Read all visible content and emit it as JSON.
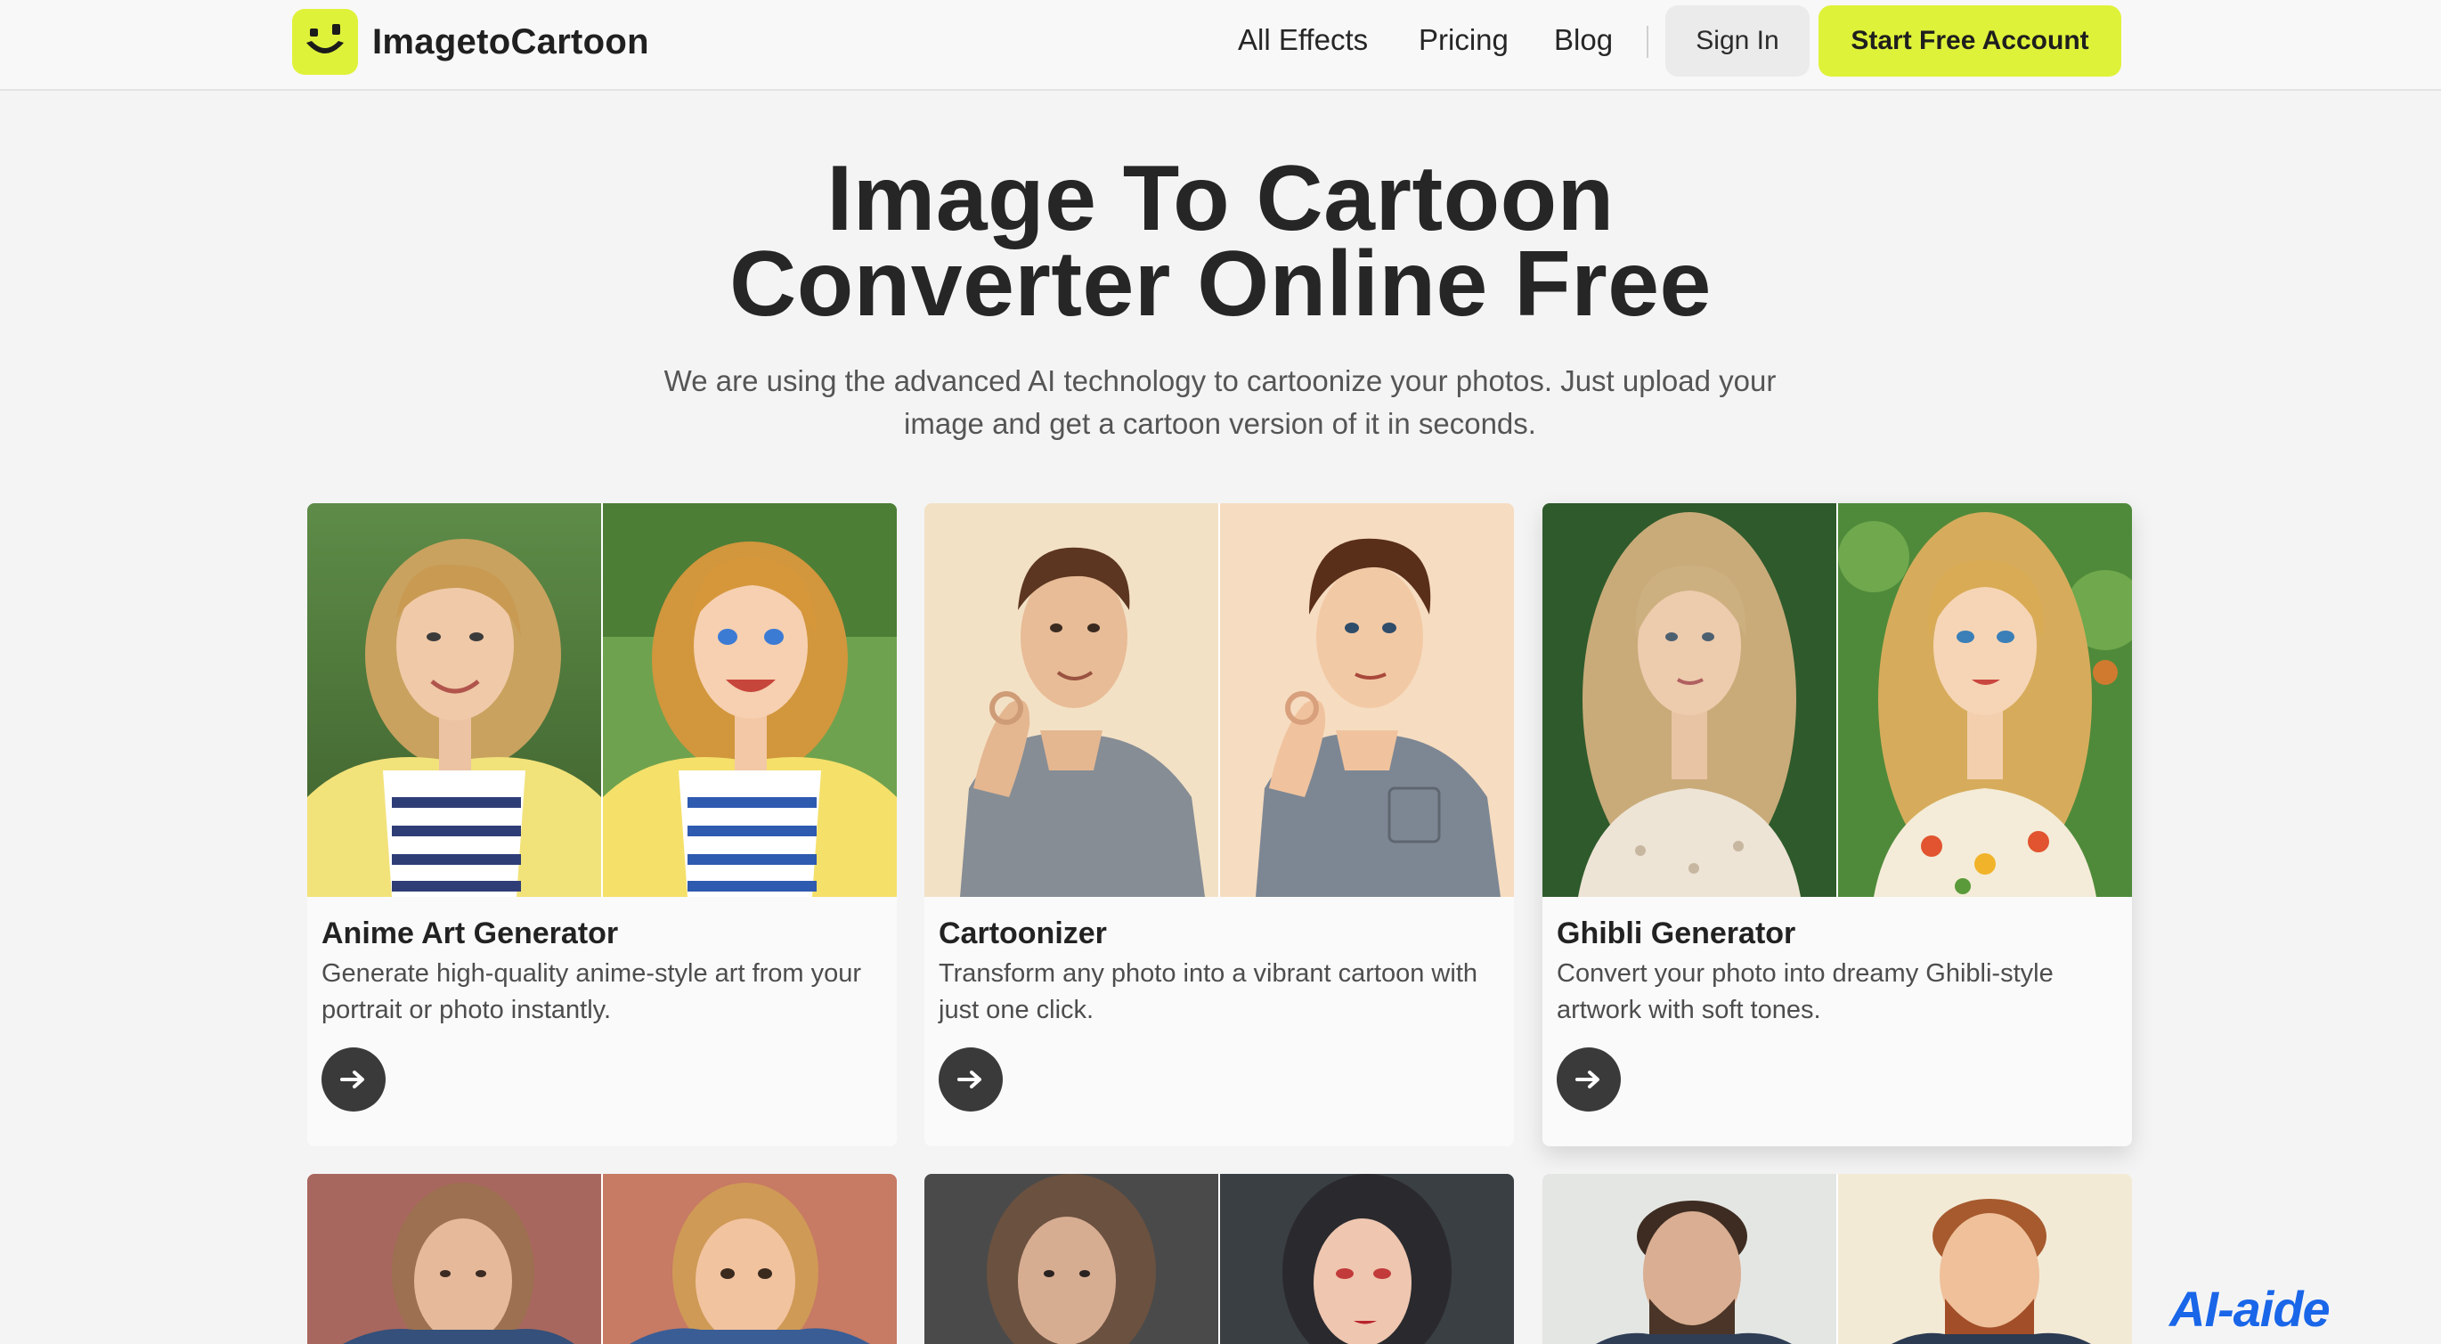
{
  "header": {
    "brand": "ImagetoCartoon",
    "logo_icon": "smiley-logo-icon",
    "nav": [
      "All Effects",
      "Pricing",
      "Blog"
    ],
    "sign_in": "Sign In",
    "start": "Start Free Account"
  },
  "hero": {
    "title_line1": "Image To Cartoon",
    "title_line2": "Converter Online Free",
    "subtitle": "We are using the advanced AI technology to cartoonize your photos. Just upload your image and get a cartoon version of it in seconds."
  },
  "cards": [
    {
      "title": "Anime Art Generator",
      "desc": "Generate high-quality anime-style art from your portrait or photo instantly."
    },
    {
      "title": "Cartoonizer",
      "desc": "Transform any photo into a vibrant cartoon with just one click."
    },
    {
      "title": "Ghibli Generator",
      "desc": "Convert your photo into dreamy Ghibli-style artwork with soft tones."
    }
  ],
  "watermark": "AI-aide",
  "colors": {
    "accent": "#dff23a",
    "button_dark": "#3a3a3a",
    "page_bg": "#f4f4f4"
  }
}
